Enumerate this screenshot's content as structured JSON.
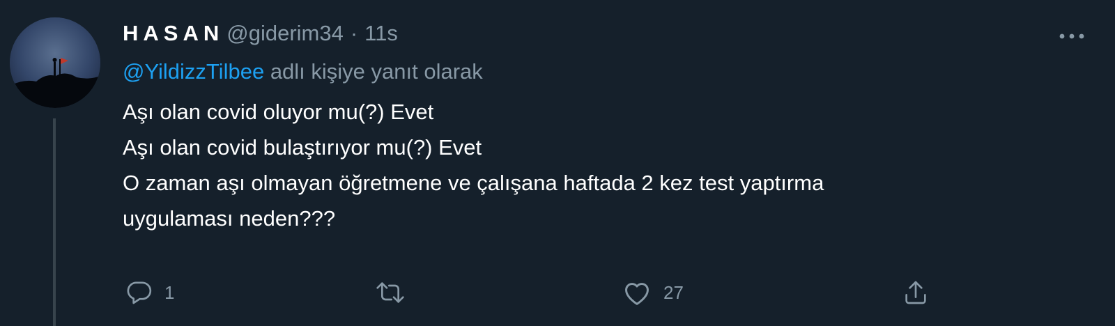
{
  "tweet": {
    "display_name": "HASAN",
    "handle": "@giderim34",
    "separator": "·",
    "time": "11s",
    "reply_to": {
      "mention": "@YildizzTilbee",
      "suffix": "adlı kişiye yanıt olarak"
    },
    "body_lines": [
      "Aşı olan covid oluyor mu(?) Evet",
      "Aşı olan covid bulaştırıyor mu(?) Evet",
      "O zaman aşı olmayan öğretmene ve çalışana haftada 2 kez test yaptırma",
      "uygulaması neden???"
    ],
    "actions": {
      "reply": {
        "icon": "reply-icon",
        "count": "1"
      },
      "retweet": {
        "icon": "retweet-icon",
        "count": ""
      },
      "like": {
        "icon": "heart-icon",
        "count": "27"
      },
      "share": {
        "icon": "share-icon"
      }
    },
    "more_icon": "more-icon",
    "avatar_icon": "avatar"
  },
  "colors": {
    "background": "#15202b",
    "primary_text": "#ffffff",
    "secondary_text": "#8899a6",
    "link": "#1da1f2",
    "thread_line": "#38444d"
  }
}
